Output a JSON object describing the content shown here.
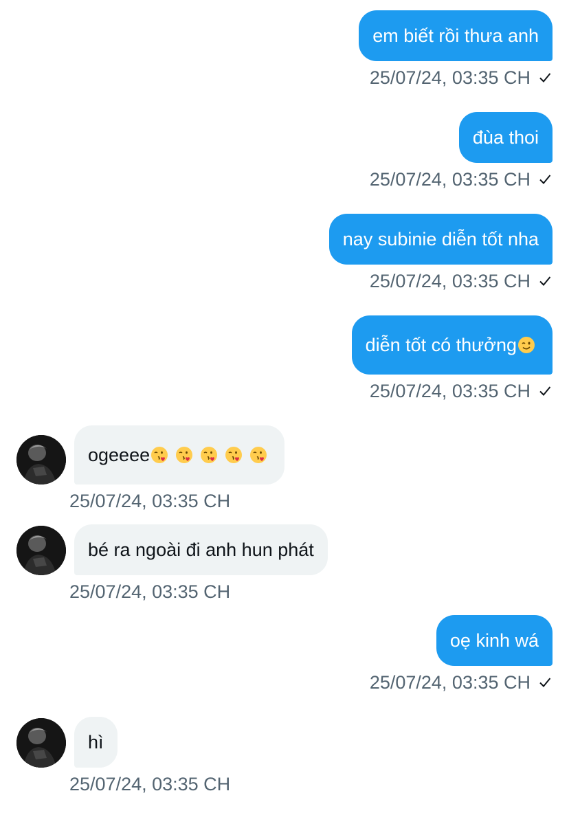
{
  "colors": {
    "outgoing_bubble": "#1d9bf0",
    "incoming_bubble": "#eff3f4",
    "timestamp": "#536471"
  },
  "messages": [
    {
      "direction": "outgoing",
      "text": "em biết rồi thưa anh",
      "time": "25/07/24, 03:35 CH",
      "read_icon": "check-icon"
    },
    {
      "direction": "outgoing",
      "text": "đùa thoi",
      "time": "25/07/24, 03:35 CH",
      "read_icon": "check-icon"
    },
    {
      "direction": "outgoing",
      "text": "nay subinie diễn tốt nha",
      "time": "25/07/24, 03:35 CH",
      "read_icon": "check-icon"
    },
    {
      "direction": "outgoing",
      "text": "diễn tốt có thưởng",
      "emoji": "winking-face-emoji",
      "time": "25/07/24, 03:35 CH",
      "read_icon": "check-icon"
    },
    {
      "direction": "incoming",
      "text": "ogeeee",
      "emojis": [
        "face-blowing-kiss-emoji",
        "face-blowing-kiss-emoji",
        "face-blowing-kiss-emoji",
        "face-blowing-kiss-emoji",
        "face-blowing-kiss-emoji"
      ],
      "time": "25/07/24, 03:35 CH",
      "avatar": "avatar-icon"
    },
    {
      "direction": "incoming",
      "text": "bé ra ngoài đi anh hun phát",
      "time": "25/07/24, 03:35 CH",
      "avatar": "avatar-icon"
    },
    {
      "direction": "outgoing",
      "text": "oẹ kinh wá",
      "time": "25/07/24, 03:35 CH",
      "read_icon": "check-icon"
    },
    {
      "direction": "incoming",
      "text": "hì",
      "time": "25/07/24, 03:35 CH",
      "avatar": "avatar-icon"
    }
  ]
}
